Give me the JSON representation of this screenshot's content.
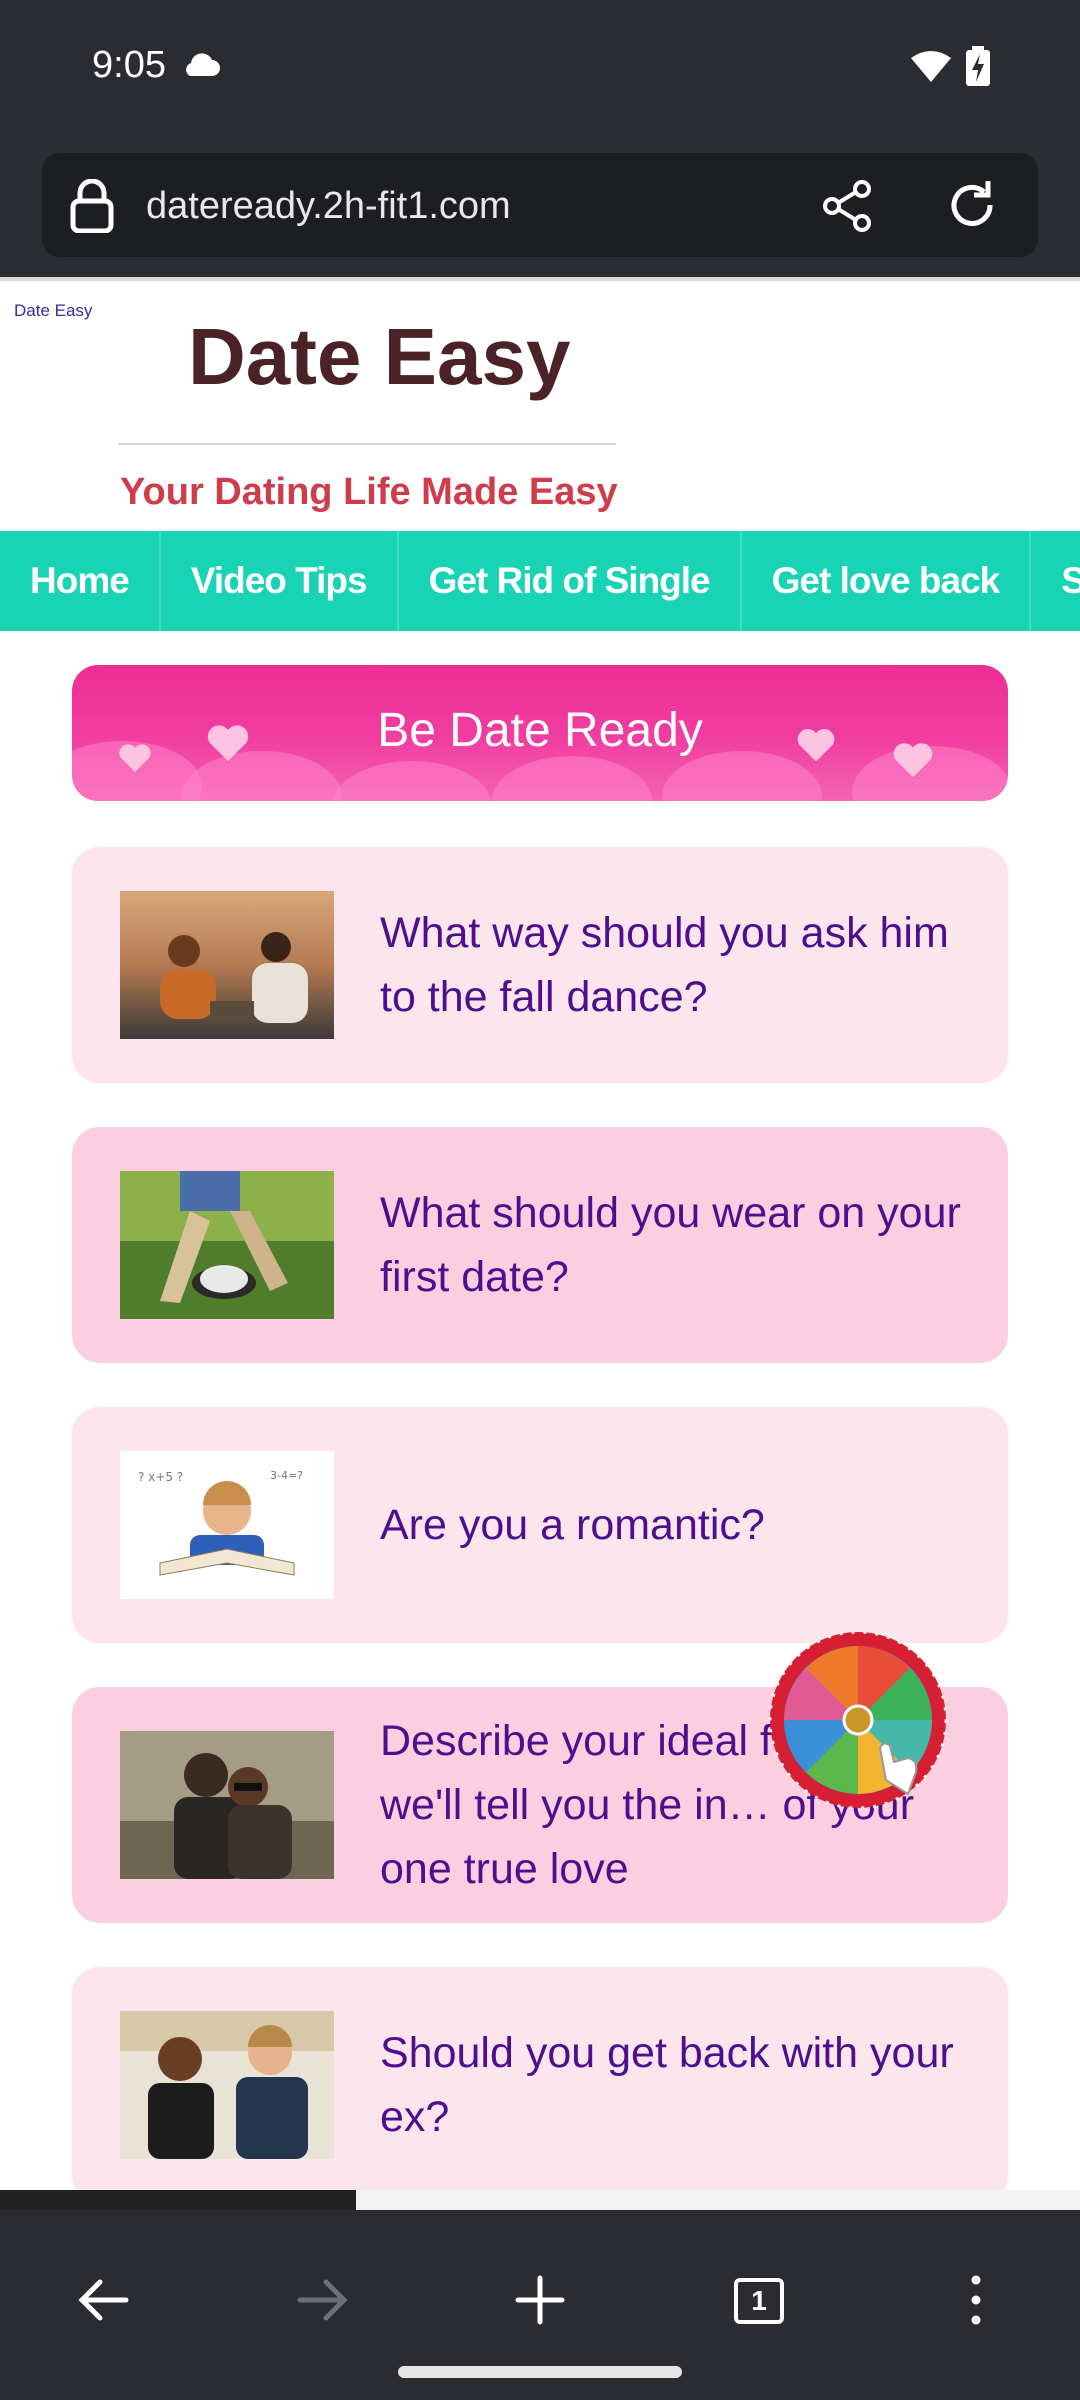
{
  "status": {
    "time": "9:05",
    "icons": [
      "cloud-icon",
      "wifi-icon",
      "battery-charging-icon"
    ]
  },
  "browser": {
    "url": "dateready.2h-fit1.com",
    "icons": [
      "lock-icon",
      "share-icon",
      "reload-icon"
    ]
  },
  "site": {
    "tag": "Date Easy",
    "title": "Date Easy",
    "tagline": "Your Dating Life Made Easy"
  },
  "nav": {
    "items": [
      {
        "label": "Home"
      },
      {
        "label": "Video Tips"
      },
      {
        "label": "Get Rid of Single"
      },
      {
        "label": "Get love back"
      },
      {
        "label": "Spar"
      }
    ]
  },
  "banner": {
    "title": "Be Date Ready"
  },
  "cards": [
    {
      "text": "What way should you ask him to the fall dance?",
      "image": "couple-picnic-photo"
    },
    {
      "text": "What should you wear on your first date?",
      "image": "clock-legs-photo"
    },
    {
      "text": "Are you a romantic?",
      "image": "boy-reading-book-photo"
    },
    {
      "text": "Describe your ideal f… and we'll tell you the in… of your one true love",
      "image": "couple-hugging-photo"
    },
    {
      "text": "Should you get back with your ex?",
      "image": "couple-talking-photo"
    }
  ],
  "overlay": {
    "wheel_icon": "prize-wheel-icon"
  },
  "toolbar": {
    "icons": [
      "back-arrow-icon",
      "forward-arrow-icon",
      "new-tab-plus-icon",
      "tab-count-icon",
      "more-menu-icon"
    ],
    "tab_count": "1"
  },
  "colors": {
    "nav_bg": "#18d3b4",
    "banner_pink": "#ee2e94",
    "card_text": "#4d0f8e",
    "tagline_red": "#cf3c4a",
    "title_dark": "#4a2228"
  }
}
